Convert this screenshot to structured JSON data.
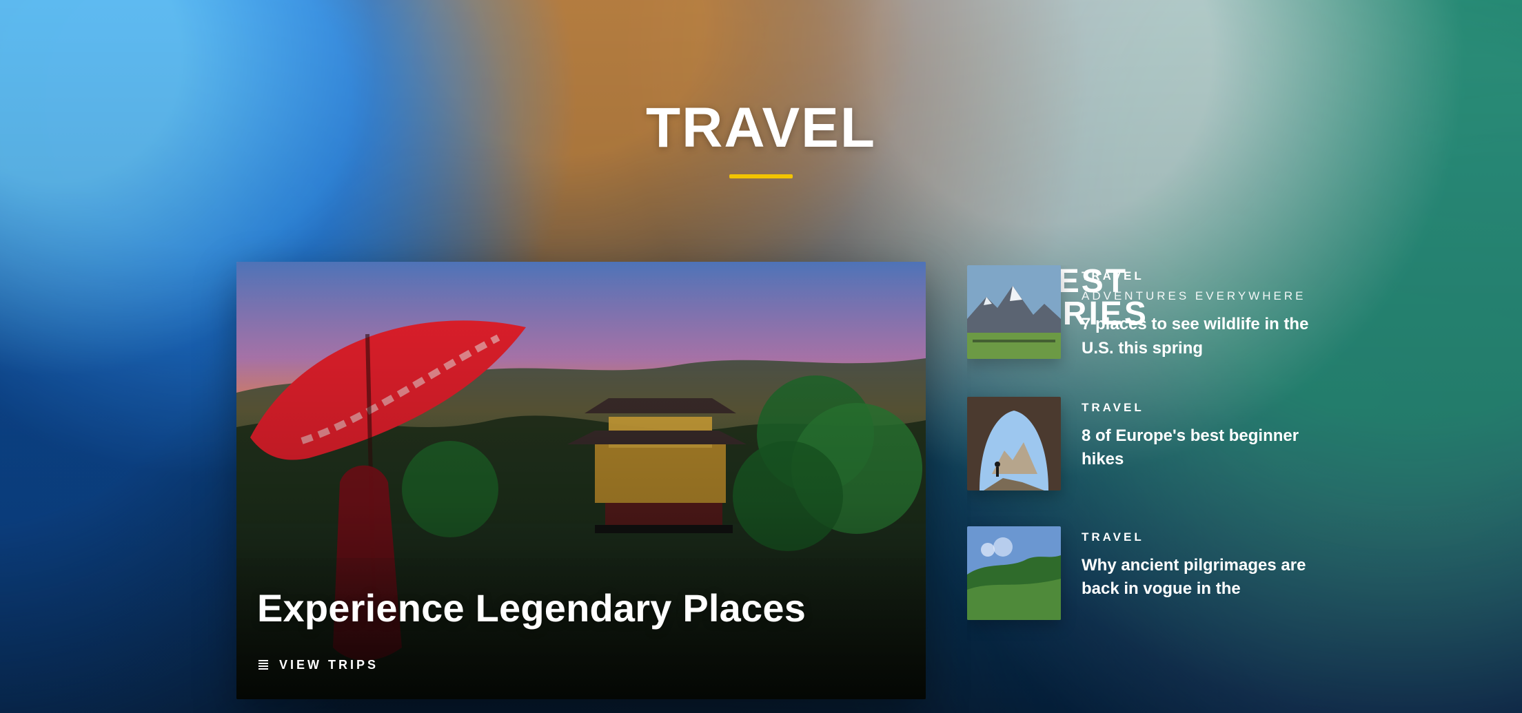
{
  "colors": {
    "accent": "#f2c400"
  },
  "page": {
    "title": "TRAVEL"
  },
  "feature": {
    "title": "Experience Legendary Places",
    "cta_label": "VIEW TRIPS",
    "cta_icon": "list-icon"
  },
  "latest": {
    "title_line1": "LATEST",
    "title_line2": "STORIES",
    "items": [
      {
        "kicker": "TRAVEL",
        "subkicker": "ADVENTURES EVERYWHERE",
        "headline": "7 places to see wildlife in the U.S. this spring",
        "thumb_icon": "mountain-icon"
      },
      {
        "kicker": "TRAVEL",
        "subkicker": "",
        "headline": "8 of Europe's best beginner hikes",
        "thumb_icon": "cave-icon"
      },
      {
        "kicker": "TRAVEL",
        "subkicker": "",
        "headline": "Why ancient pilgrimages are back in vogue in the",
        "thumb_icon": "landscape-icon"
      }
    ]
  }
}
